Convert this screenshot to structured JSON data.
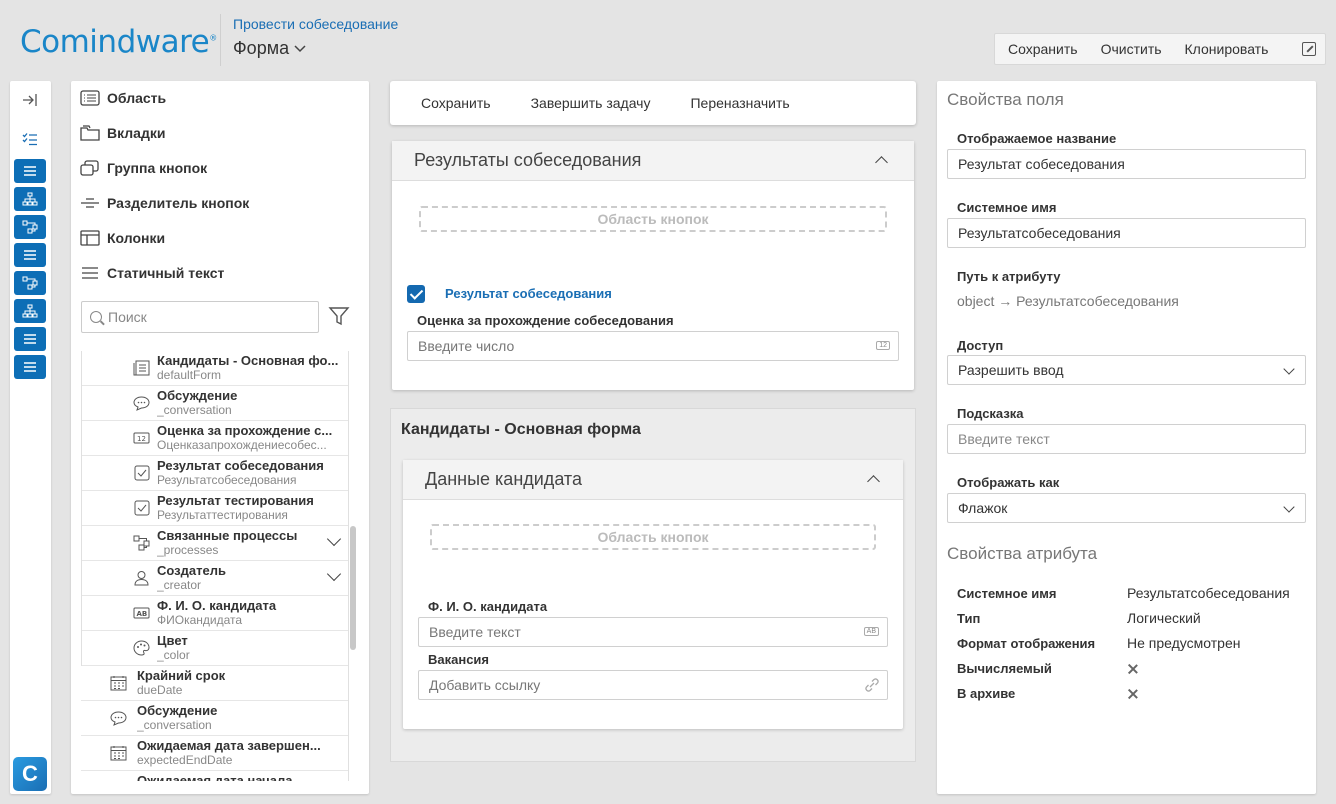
{
  "header": {
    "logo": "Comindware",
    "breadcrumb_link": "Провести собеседование",
    "form_title": "Форма",
    "actions": {
      "save": "Сохранить",
      "clear": "Очистить",
      "clone": "Клонировать"
    }
  },
  "palette": {
    "items": [
      "Область",
      "Вкладки",
      "Группа кнопок",
      "Разделитель кнопок",
      "Колонки",
      "Статичный текст"
    ],
    "search_placeholder": "Поиск",
    "tree": [
      {
        "name": "Кандидаты - Основная фо...",
        "sys": "defaultForm",
        "icon": "form-icon"
      },
      {
        "name": "Обсуждение",
        "sys": "_conversation",
        "icon": "chat-icon"
      },
      {
        "name": "Оценка за прохождение с...",
        "sys": "Оценказапрохождениесобес...",
        "icon": "number-icon"
      },
      {
        "name": "Результат собеседования",
        "sys": "Результатсобеседования",
        "icon": "checkbox-icon"
      },
      {
        "name": "Результат тестирования",
        "sys": "Результаттестирования",
        "icon": "checkbox-icon"
      },
      {
        "name": "Связанные процессы",
        "sys": "_processes",
        "icon": "process-icon"
      },
      {
        "name": "Создатель",
        "sys": "_creator",
        "icon": "user-icon"
      },
      {
        "name": "Ф. И. О. кандидата",
        "sys": "ФИОкандидата",
        "icon": "text-icon"
      },
      {
        "name": "Цвет",
        "sys": "_color",
        "icon": "palette-icon"
      },
      {
        "name": "Крайний срок",
        "sys": "dueDate",
        "icon": "calendar-icon"
      },
      {
        "name": "Обсуждение",
        "sys": "_conversation",
        "icon": "chat-icon"
      },
      {
        "name": "Ожидаемая дата завершен...",
        "sys": "expectedEndDate",
        "icon": "calendar-icon"
      },
      {
        "name": "Ожидаемая дата начала",
        "sys": "",
        "icon": "calendar-icon"
      }
    ]
  },
  "toolbar": {
    "save": "Сохранить",
    "complete": "Завершить задачу",
    "reassign": "Переназначить"
  },
  "results_panel": {
    "title": "Результаты собеседования",
    "button_area": "Область кнопок",
    "checkbox_label": "Результат собеседования",
    "score_label": "Оценка за прохождение собеседования",
    "score_placeholder": "Введите число",
    "score_tag": "12"
  },
  "candidates_group": {
    "title": "Кандидаты - Основная форма",
    "panel_title": "Данные кандидата",
    "button_area": "Область кнопок",
    "fio_label": "Ф. И. О. кандидата",
    "fio_placeholder": "Введите текст",
    "fio_tag": "AB",
    "vacancy_label": "Вакансия",
    "vacancy_placeholder": "Добавить ссылку"
  },
  "props": {
    "section_field": "Свойства поля",
    "display_name_label": "Отображаемое название",
    "display_name_value": "Результат собеседования",
    "system_name_label": "Системное имя",
    "system_name_value": "Результатсобеседования",
    "attr_path_label": "Путь к атрибуту",
    "attr_path_value": "object → Результатсобеседования",
    "access_label": "Доступ",
    "access_value": "Разрешить ввод",
    "hint_label": "Подсказка",
    "hint_placeholder": "Введите текст",
    "display_as_label": "Отображать как",
    "display_as_value": "Флажок",
    "section_attr": "Свойства атрибута",
    "attr": [
      {
        "k": "Системное имя",
        "v": "Результатсобеседования"
      },
      {
        "k": "Тип",
        "v": "Логический"
      },
      {
        "k": "Формат отображения",
        "v": "Не предусмотрен"
      },
      {
        "k": "Вычисляемый",
        "v": ""
      },
      {
        "k": "В архиве",
        "v": ""
      }
    ]
  }
}
